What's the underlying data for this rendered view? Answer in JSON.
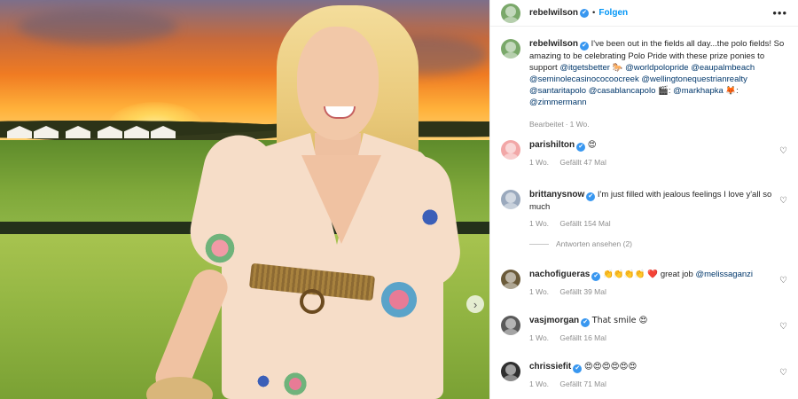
{
  "post": {
    "author": "rebelwilson",
    "follow_label": "Folgen",
    "dot": "•",
    "more_label": "•••"
  },
  "caption": {
    "username": "rebelwilson",
    "text": "I've been out in the fields all day...the polo fields! So amazing to be celebrating Polo Pride with these prize ponies to support",
    "tags": [
      "@itgetsbetter",
      "🐎",
      "@worldpolopride",
      "@eaupalmbeach",
      "@seminolecasinococoocreek",
      "@wellingtonequestrianrealty",
      "@santaritapolo",
      "@casablancapolo",
      "🎬",
      ":",
      "@markhapka",
      "🦊",
      ":",
      "@zimmermann"
    ],
    "edited": "Bearbeitet",
    "time": "1 Wo."
  },
  "comments": [
    {
      "username": "parishilton",
      "text": "😍",
      "time": "1 Wo.",
      "likes": "Gefällt 47 Mal",
      "avatar_color": "#f2a7a7"
    },
    {
      "username": "brittanysnow",
      "text": "I'm just filled with jealous feelings I love y'all so much",
      "time": "1 Wo.",
      "likes": "Gefällt 154 Mal",
      "replies": "Antworten ansehen (2)",
      "avatar_color": "#9aa9bd"
    },
    {
      "username": "nachofigueras",
      "text": "👏👏👏👏 ❤️",
      "mention_suffix": "great job",
      "mention": "@melissaganzi",
      "time": "1 Wo.",
      "likes": "Gefällt 39 Mal",
      "avatar_color": "#6b5b3a"
    },
    {
      "username": "vasjmorgan",
      "text": "That smile 😍",
      "time": "1 Wo.",
      "likes": "Gefällt 16 Mal",
      "avatar_color": "#5a5a5a"
    },
    {
      "username": "chrissiefit",
      "text": "😍😍😍😍😍😍",
      "time": "1 Wo.",
      "likes": "Gefällt 71 Mal",
      "avatar_color": "#2f2f2f"
    }
  ],
  "icons": {
    "verified": "✔",
    "heart": "♡",
    "next": "›"
  },
  "colors": {
    "link": "#00376b",
    "follow": "#0095f6",
    "verified": "#3897f0",
    "meta": "#8e8e8e",
    "owner_avatar": "#7aa86a"
  }
}
